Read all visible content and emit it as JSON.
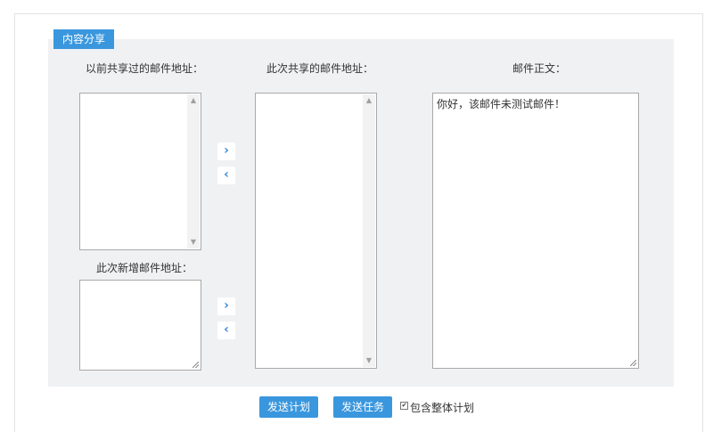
{
  "section": {
    "tab_label": "内容分享"
  },
  "labels": {
    "previous_shared": "以前共享过的邮件地址：",
    "current_shared": "此次共享的邮件地址：",
    "email_body": "邮件正文：",
    "new_added": "此次新增邮件地址："
  },
  "email_body_text": "你好，该邮件未测试邮件！",
  "arrows": {
    "move_right": "›",
    "move_left": "‹"
  },
  "scrollbar": {
    "up": "▲",
    "down": "▼"
  },
  "buttons": {
    "send_plan": "发送计划",
    "send_task": "发送任务"
  },
  "checkbox": {
    "label": "包含整体计划",
    "checked": true,
    "mark": "✔"
  }
}
